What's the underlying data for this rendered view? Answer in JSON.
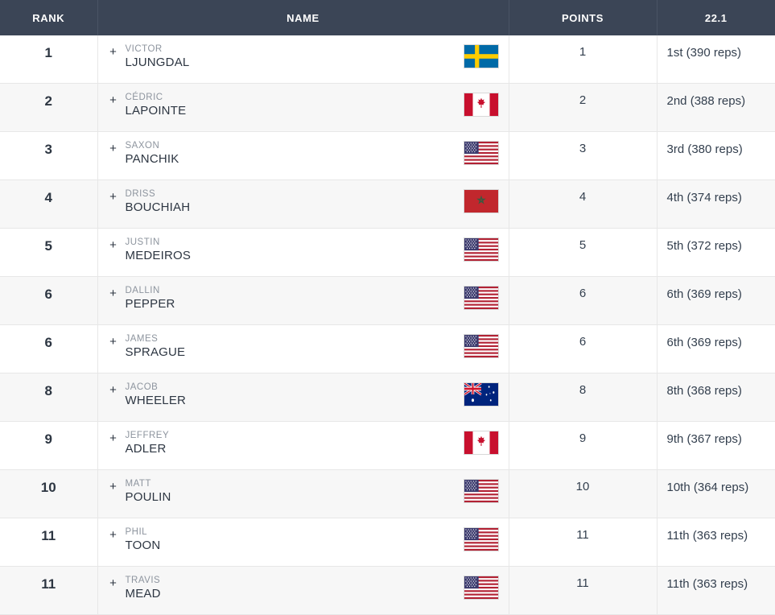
{
  "table": {
    "columns": [
      {
        "key": "rank",
        "label": "RANK"
      },
      {
        "key": "name",
        "label": "NAME"
      },
      {
        "key": "points",
        "label": "POINTS"
      },
      {
        "key": "score",
        "label": "22.1"
      }
    ],
    "expand_icon": "+",
    "rows": [
      {
        "rank": "1",
        "first_name": "VICTOR",
        "last_name": "LJUNGDAL",
        "flag": "sweden",
        "points": "1",
        "score": "1st (390 reps)"
      },
      {
        "rank": "2",
        "first_name": "CÉDRIC",
        "last_name": "LAPOINTE",
        "flag": "canada",
        "points": "2",
        "score": "2nd (388 reps)"
      },
      {
        "rank": "3",
        "first_name": "SAXON",
        "last_name": "PANCHIK",
        "flag": "usa",
        "points": "3",
        "score": "3rd (380 reps)"
      },
      {
        "rank": "4",
        "first_name": "DRISS",
        "last_name": "BOUCHIAH",
        "flag": "morocco",
        "points": "4",
        "score": "4th (374 reps)"
      },
      {
        "rank": "5",
        "first_name": "JUSTIN",
        "last_name": "MEDEIROS",
        "flag": "usa",
        "points": "5",
        "score": "5th (372 reps)"
      },
      {
        "rank": "6",
        "first_name": "DALLIN",
        "last_name": "PEPPER",
        "flag": "usa",
        "points": "6",
        "score": "6th (369 reps)"
      },
      {
        "rank": "6",
        "first_name": "JAMES",
        "last_name": "SPRAGUE",
        "flag": "usa",
        "points": "6",
        "score": "6th (369 reps)"
      },
      {
        "rank": "8",
        "first_name": "JACOB",
        "last_name": "WHEELER",
        "flag": "australia",
        "points": "8",
        "score": "8th (368 reps)"
      },
      {
        "rank": "9",
        "first_name": "JEFFREY",
        "last_name": "ADLER",
        "flag": "canada",
        "points": "9",
        "score": "9th (367 reps)"
      },
      {
        "rank": "10",
        "first_name": "MATT",
        "last_name": "POULIN",
        "flag": "usa",
        "points": "10",
        "score": "10th (364 reps)"
      },
      {
        "rank": "11",
        "first_name": "PHIL",
        "last_name": "TOON",
        "flag": "usa",
        "points": "11",
        "score": "11th (363 reps)"
      },
      {
        "rank": "11",
        "first_name": "TRAVIS",
        "last_name": "MEAD",
        "flag": "usa",
        "points": "11",
        "score": "11th (363 reps)"
      }
    ]
  },
  "colors": {
    "header_bg": "#3b4556",
    "header_text": "#ffffff",
    "row_bg": "#ffffff",
    "row_alt_bg": "#f7f7f7",
    "border": "#e7e7e7",
    "first_name_text": "#8d949e",
    "last_name_text": "#2d3642"
  }
}
